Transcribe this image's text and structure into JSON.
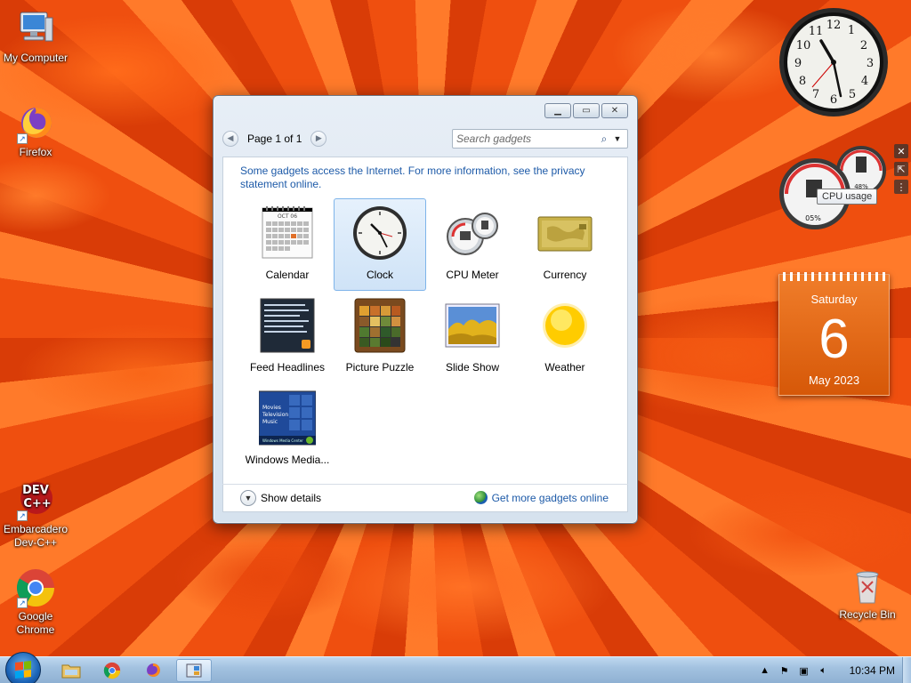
{
  "desktop": {
    "icons": [
      {
        "label": "My Computer"
      },
      {
        "label": "Firefox"
      },
      {
        "label": "Embarcadero Dev-C++",
        "logo_text": "DEV C++"
      },
      {
        "label": "Google Chrome"
      },
      {
        "label": "Recycle Bin"
      }
    ]
  },
  "gallery": {
    "page_label": "Page 1 of 1",
    "search_placeholder": "Search gadgets",
    "notice": "Some gadgets access the Internet.  For more information, see the privacy statement online.",
    "gadgets": [
      {
        "label": "Calendar",
        "icon": "calendar-icon",
        "thumb_text": "OCT 06"
      },
      {
        "label": "Clock",
        "icon": "clock-icon",
        "selected": true
      },
      {
        "label": "CPU Meter",
        "icon": "cpu-meter-icon"
      },
      {
        "label": "Currency",
        "icon": "currency-icon"
      },
      {
        "label": "Feed Headlines",
        "icon": "feed-headlines-icon"
      },
      {
        "label": "Picture Puzzle",
        "icon": "picture-puzzle-icon"
      },
      {
        "label": "Slide Show",
        "icon": "slide-show-icon"
      },
      {
        "label": "Weather",
        "icon": "weather-icon"
      },
      {
        "label": "Windows Media...",
        "icon": "windows-media-icon",
        "thumb_lines": [
          "Movies",
          "Television",
          "Music"
        ],
        "thumb_footer": "Windows Media Center"
      }
    ],
    "show_details": "Show details",
    "get_more": "Get more gadgets online"
  },
  "desktop_gadgets": {
    "clock_numbers": [
      "12",
      "1",
      "2",
      "3",
      "4",
      "5",
      "6",
      "7",
      "8",
      "9",
      "10",
      "11"
    ],
    "cpu_tooltip": "CPU usage",
    "cpu_percent": "05%",
    "memory_percent": "48%",
    "calendar": {
      "weekday": "Saturday",
      "day": "6",
      "month_year": "May 2023"
    }
  },
  "taskbar": {
    "time": "10:34 PM"
  },
  "colors": {
    "link_blue": "#1d5aa8",
    "calendar_orange": "#e0640f",
    "taskbar_blue": "#a3c2e0"
  }
}
